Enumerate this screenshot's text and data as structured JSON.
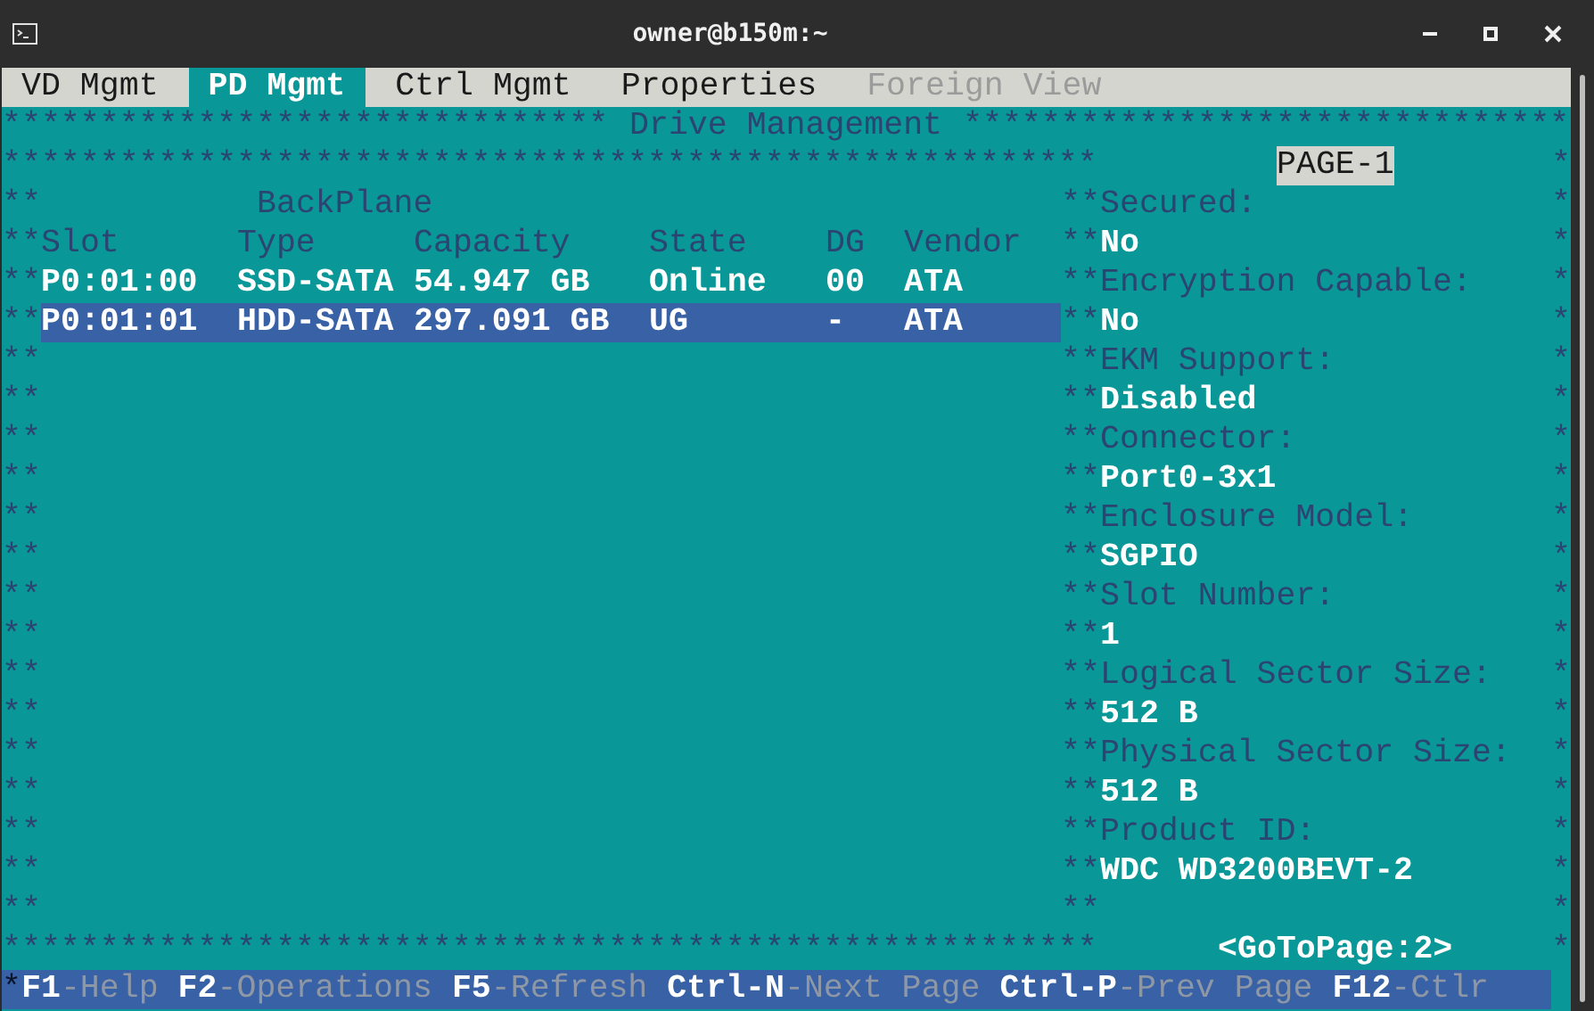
{
  "window": {
    "title": "owner@b150m:~"
  },
  "tabs": [
    {
      "label": "VD Mgmt",
      "selected": false,
      "disabled": false
    },
    {
      "label": "PD Mgmt",
      "selected": true,
      "disabled": false
    },
    {
      "label": "Ctrl Mgmt",
      "selected": false,
      "disabled": false
    },
    {
      "label": "Properties",
      "selected": false,
      "disabled": false
    },
    {
      "label": "Foreign View",
      "selected": false,
      "disabled": true
    }
  ],
  "banner": {
    "left": "*******************************",
    "title": "Drive Management",
    "right": "*******************************"
  },
  "top_rule": "********************************************************",
  "page_label": "PAGE-1",
  "left_border": "**\n**\n**\n**\n**\n**\n**\n**\n**\n**\n**\n**\n**\n**\n**\n**\n**\n**\n**",
  "mid_border": "**\n**\n**\n**\n**\n**\n**\n**\n**\n**\n**\n**\n**\n**\n**\n**\n**\n**\n**",
  "right_border": "*\n*\n*\n*\n*\n*\n*\n*\n*\n*\n*\n*\n*\n*\n*\n*\n*\n*\n*\n*\n*",
  "drive_list": {
    "section": "BackPlane",
    "columns": [
      "Slot",
      "Type",
      "Capacity",
      "State",
      "DG",
      "Vendor"
    ],
    "rows": [
      {
        "cells": [
          "P0:01:00",
          "SSD-SATA",
          "54.947 GB",
          "Online",
          "00",
          "ATA"
        ],
        "selected": false
      },
      {
        "cells": [
          "P0:01:01",
          "HDD-SATA",
          "297.091 GB",
          "UG",
          "-",
          "ATA"
        ],
        "selected": true
      }
    ]
  },
  "details": [
    {
      "label": "Secured:",
      "value": "No"
    },
    {
      "label": "Encryption Capable:",
      "value": "No"
    },
    {
      "label": "EKM Support:",
      "value": "Disabled"
    },
    {
      "label": "Connector:",
      "value": "Port0-3x1"
    },
    {
      "label": "Enclosure Model:",
      "value": "SGPIO"
    },
    {
      "label": "Slot Number:",
      "value": "1"
    },
    {
      "label": "Logical Sector Size:",
      "value": "512 B"
    },
    {
      "label": "Physical Sector Size:",
      "value": "512 B"
    },
    {
      "label": "Product ID:",
      "value": "WDC WD3200BEVT-2"
    }
  ],
  "bottom_rule": "********************************************************",
  "goto_page": "<GoToPage:2>",
  "status_bar": {
    "edge": "*",
    "keys": [
      {
        "key": "F1",
        "label": "-Help"
      },
      {
        "key": "F2",
        "label": "-Operations"
      },
      {
        "key": "F5",
        "label": "-Refresh"
      },
      {
        "key": "Ctrl-N",
        "label": "-Next Page"
      },
      {
        "key": "Ctrl-P",
        "label": "-Prev Page"
      },
      {
        "key": "F12",
        "label": "-Ctlr"
      }
    ]
  }
}
